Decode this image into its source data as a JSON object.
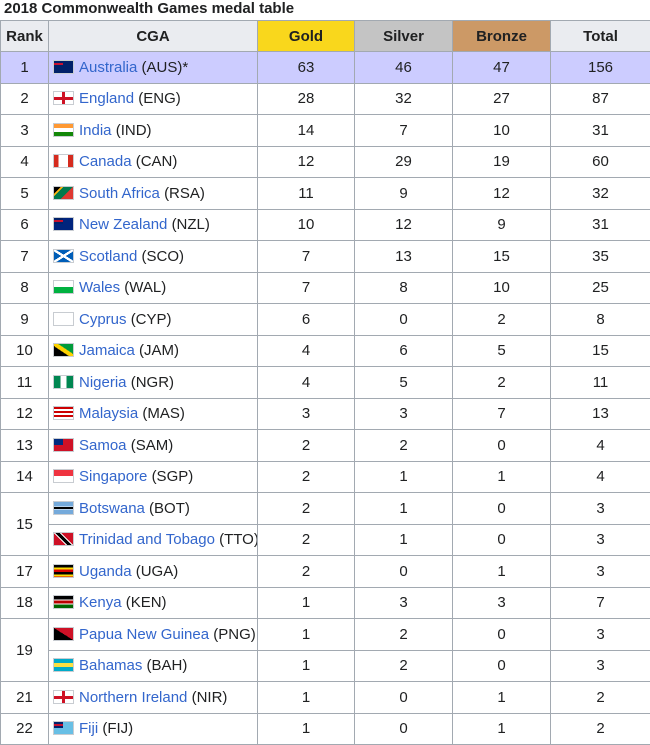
{
  "caption": "2018 Commonwealth Games medal table",
  "headers": {
    "rank": "Rank",
    "cga": "CGA",
    "gold": "Gold",
    "silver": "Silver",
    "bronze": "Bronze",
    "total": "Total"
  },
  "colors": {
    "gold_header": "#f9d71c",
    "silver_header": "#c4c4c4",
    "bronze_header": "#cc9966",
    "host_row": "#ccccff",
    "link": "#3366cc"
  },
  "rows": [
    {
      "rank": "1",
      "name": "Australia",
      "code": "(AUS)*",
      "gold": "63",
      "silver": "46",
      "bronze": "47",
      "total": "156",
      "flag_icon": "australia-flag-icon"
    },
    {
      "rank": "2",
      "name": "England",
      "code": "(ENG)",
      "gold": "28",
      "silver": "32",
      "bronze": "27",
      "total": "87",
      "flag_icon": "england-flag-icon"
    },
    {
      "rank": "3",
      "name": "India",
      "code": "(IND)",
      "gold": "14",
      "silver": "7",
      "bronze": "10",
      "total": "31",
      "flag_icon": "india-flag-icon"
    },
    {
      "rank": "4",
      "name": "Canada",
      "code": "(CAN)",
      "gold": "12",
      "silver": "29",
      "bronze": "19",
      "total": "60",
      "flag_icon": "canada-flag-icon"
    },
    {
      "rank": "5",
      "name": "South Africa",
      "code": "(RSA)",
      "gold": "11",
      "silver": "9",
      "bronze": "12",
      "total": "32",
      "flag_icon": "south-africa-flag-icon"
    },
    {
      "rank": "6",
      "name": "New Zealand",
      "code": "(NZL)",
      "gold": "10",
      "silver": "12",
      "bronze": "9",
      "total": "31",
      "flag_icon": "new-zealand-flag-icon"
    },
    {
      "rank": "7",
      "name": "Scotland",
      "code": "(SCO)",
      "gold": "7",
      "silver": "13",
      "bronze": "15",
      "total": "35",
      "flag_icon": "scotland-flag-icon"
    },
    {
      "rank": "8",
      "name": "Wales",
      "code": "(WAL)",
      "gold": "7",
      "silver": "8",
      "bronze": "10",
      "total": "25",
      "flag_icon": "wales-flag-icon"
    },
    {
      "rank": "9",
      "name": "Cyprus",
      "code": "(CYP)",
      "gold": "6",
      "silver": "0",
      "bronze": "2",
      "total": "8",
      "flag_icon": "cyprus-flag-icon"
    },
    {
      "rank": "10",
      "name": "Jamaica",
      "code": "(JAM)",
      "gold": "4",
      "silver": "6",
      "bronze": "5",
      "total": "15",
      "flag_icon": "jamaica-flag-icon"
    },
    {
      "rank": "11",
      "name": "Nigeria",
      "code": "(NGR)",
      "gold": "4",
      "silver": "5",
      "bronze": "2",
      "total": "11",
      "flag_icon": "nigeria-flag-icon"
    },
    {
      "rank": "12",
      "name": "Malaysia",
      "code": "(MAS)",
      "gold": "3",
      "silver": "3",
      "bronze": "7",
      "total": "13",
      "flag_icon": "malaysia-flag-icon"
    },
    {
      "rank": "13",
      "name": "Samoa",
      "code": "(SAM)",
      "gold": "2",
      "silver": "2",
      "bronze": "0",
      "total": "4",
      "flag_icon": "samoa-flag-icon"
    },
    {
      "rank": "14",
      "name": "Singapore",
      "code": "(SGP)",
      "gold": "2",
      "silver": "1",
      "bronze": "1",
      "total": "4",
      "flag_icon": "singapore-flag-icon"
    },
    {
      "rank": "15",
      "name": "Botswana",
      "code": "(BOT)",
      "gold": "2",
      "silver": "1",
      "bronze": "0",
      "total": "3",
      "flag_icon": "botswana-flag-icon"
    },
    {
      "rank": "",
      "name": "Trinidad and Tobago",
      "code": "(TTO)",
      "gold": "2",
      "silver": "1",
      "bronze": "0",
      "total": "3",
      "flag_icon": "trinidad-and-tobago-flag-icon"
    },
    {
      "rank": "17",
      "name": "Uganda",
      "code": "(UGA)",
      "gold": "2",
      "silver": "0",
      "bronze": "1",
      "total": "3",
      "flag_icon": "uganda-flag-icon"
    },
    {
      "rank": "18",
      "name": "Kenya",
      "code": "(KEN)",
      "gold": "1",
      "silver": "3",
      "bronze": "3",
      "total": "7",
      "flag_icon": "kenya-flag-icon"
    },
    {
      "rank": "19",
      "name": "Papua New Guinea",
      "code": "(PNG)",
      "gold": "1",
      "silver": "2",
      "bronze": "0",
      "total": "3",
      "flag_icon": "papua-new-guinea-flag-icon"
    },
    {
      "rank": "",
      "name": "Bahamas",
      "code": "(BAH)",
      "gold": "1",
      "silver": "2",
      "bronze": "0",
      "total": "3",
      "flag_icon": "bahamas-flag-icon"
    },
    {
      "rank": "21",
      "name": "Northern Ireland",
      "code": "(NIR)",
      "gold": "1",
      "silver": "0",
      "bronze": "1",
      "total": "2",
      "flag_icon": "northern-ireland-flag-icon"
    },
    {
      "rank": "22",
      "name": "Fiji",
      "code": "(FIJ)",
      "gold": "1",
      "silver": "0",
      "bronze": "1",
      "total": "2",
      "flag_icon": "fiji-flag-icon"
    }
  ]
}
